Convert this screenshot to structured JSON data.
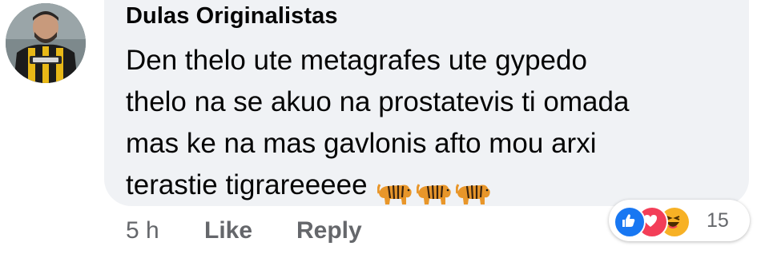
{
  "comment": {
    "author": "Dulas Originalistas",
    "lines": [
      "Den thelo ute metagrafes ute gypedo",
      "thelo na se akuo na prostatevis ti omada",
      "mas ke na mas gavlonis afto mou arxi",
      "terastie tigrareeeee"
    ],
    "emoji": [
      "tiger-icon",
      "tiger-icon",
      "tiger-icon"
    ]
  },
  "actions": {
    "time": "5 h",
    "like_label": "Like",
    "reply_label": "Reply"
  },
  "reactions": {
    "icons": [
      "like-icon",
      "love-icon",
      "haha-icon"
    ],
    "count": "15"
  },
  "colors": {
    "bubble": "#f0f2f5",
    "text": "#050505",
    "meta": "#65676b",
    "like": "#1877f2",
    "love": "#f33e58",
    "haha": "#f7b125"
  }
}
